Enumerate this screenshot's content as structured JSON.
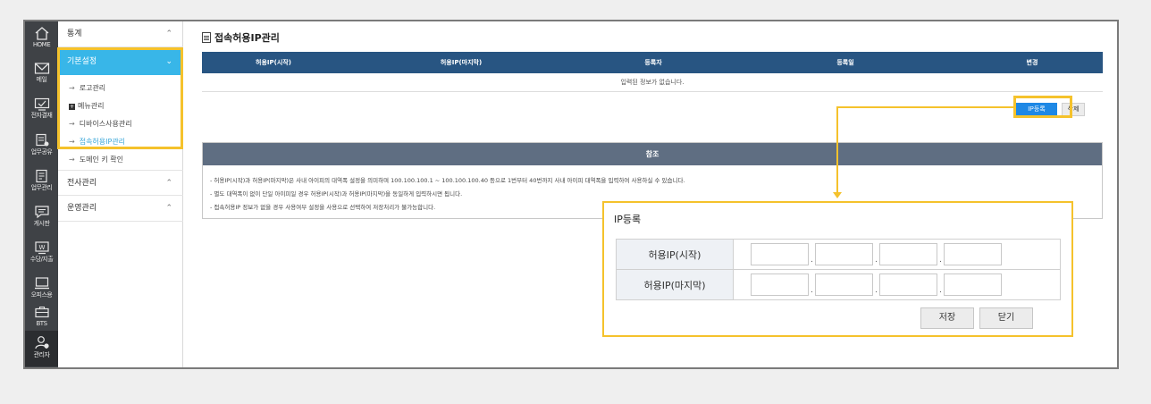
{
  "rail": [
    {
      "label": "HOME",
      "icon": "home-icon"
    },
    {
      "label": "메일",
      "icon": "mail-icon"
    },
    {
      "label": "전자결재",
      "icon": "approval-icon"
    },
    {
      "label": "업무공유",
      "icon": "share-doc-icon"
    },
    {
      "label": "업무관리",
      "icon": "task-doc-icon"
    },
    {
      "label": "게시판",
      "icon": "board-icon"
    },
    {
      "label": "수당/지출",
      "icon": "wallet-icon"
    },
    {
      "label": "오피스용",
      "icon": "monitor-icon"
    },
    {
      "label": "BTS",
      "icon": "briefcase-icon"
    },
    {
      "label": "관리자",
      "icon": "admin-icon"
    }
  ],
  "menu": {
    "stats": "통계",
    "basic": "기본설정",
    "sub": [
      "로고관리",
      "메뉴관리",
      "디바이스사용관리",
      "접속허용IP관리",
      "도메인 키 확인"
    ],
    "company": "전사관리",
    "ops": "운영관리",
    "expand_glyph": "⌃",
    "collapse_glyph": "⌄",
    "arrow_glyph": "→",
    "plus_glyph": "+"
  },
  "page": {
    "title": "접속허용IP관리",
    "columns": [
      "허용IP(시작)",
      "허용IP(마지막)",
      "등록자",
      "등록일",
      "변경"
    ],
    "empty_message": "입력된 정보가 없습니다.",
    "add_button": "IP등록",
    "delete_button": "삭제"
  },
  "reference": {
    "title": "참조",
    "lines": [
      "- 허용IP(시작)과 허용IP(마지막)은 사내 아이피의 대역폭 설정을 의미하며 100.100.100.1 ~ 100.100.100.40 등으로 1번부터 40번까지 사내 아이피 대역폭을 입력하여 사용하실 수 있습니다.",
      "- 별도 대역폭이 없이 단일 아이피일 경우 허용IP(시작)과 허용IP(마지막)을 동일하게 입력하시면 됩니다.",
      "- 접속허용IP 정보가 없을 경우 사용여부 설정을 사용으로 선택하여 저장처리가 불가능합니다."
    ]
  },
  "popup": {
    "title": "IP등록",
    "start_label": "허용IP(시작)",
    "end_label": "허용IP(마지막)",
    "separator": ".",
    "save": "저장",
    "close": "닫기"
  },
  "colors": {
    "highlight": "#f5c22c",
    "active_menu": "#38b6e8",
    "table_header": "#285582",
    "primary_button": "#1e88e5"
  }
}
